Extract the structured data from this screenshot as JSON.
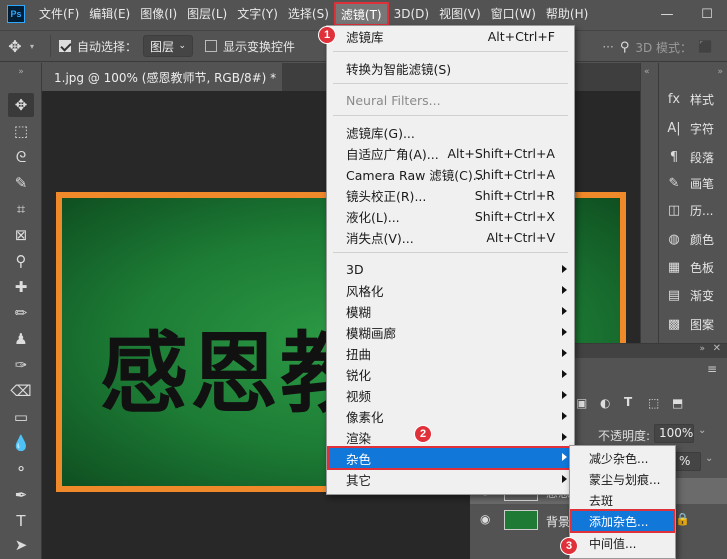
{
  "menubar": {
    "logo": "Ps",
    "items": [
      "文件(F)",
      "编辑(E)",
      "图像(I)",
      "图层(L)",
      "文字(Y)",
      "选择(S)",
      "滤镜(T)",
      "3D(D)",
      "视图(V)",
      "窗口(W)",
      "帮助(H)"
    ],
    "active_index": 6
  },
  "optionsbar": {
    "auto_select_label": "自动选择：",
    "auto_select_checked": true,
    "layer_dropdown": "图层",
    "show_transform_label": "显示变换控件",
    "mode_3d_label": "3D 模式："
  },
  "document": {
    "tab_title": "1.jpg @ 100% (感恩教师节, RGB/8#) *",
    "canvas_text": "感恩教师节"
  },
  "right_panel": {
    "items": [
      {
        "icon": "fx",
        "label": "样式"
      },
      {
        "icon": "A|",
        "label": "字符"
      },
      {
        "icon": "¶",
        "label": "段落"
      },
      {
        "icon": "✎",
        "label": "画笔"
      },
      {
        "icon": "◫",
        "label": "历..."
      },
      {
        "icon": "◍",
        "label": "颜色"
      },
      {
        "icon": "▦",
        "label": "色板"
      },
      {
        "icon": "▤",
        "label": "渐变"
      },
      {
        "icon": "▩",
        "label": "图案"
      }
    ]
  },
  "layers": {
    "opacity_label": "不透明度:",
    "opacity_value": "100%",
    "fill_value": "%",
    "layer_partial": "感恩",
    "background_label": "背景"
  },
  "filter_menu": {
    "items": [
      {
        "label": "滤镜库",
        "shortcut": "Alt+Ctrl+F"
      },
      {
        "label": "转换为智能滤镜(S)",
        "shortcut": ""
      },
      {
        "label": "Neural Filters...",
        "shortcut": "",
        "disabled": true
      },
      {
        "label": "滤镜库(G)...",
        "shortcut": ""
      },
      {
        "label": "自适应广角(A)...",
        "shortcut": "Alt+Shift+Ctrl+A"
      },
      {
        "label": "Camera Raw 滤镜(C)...",
        "shortcut": "Shift+Ctrl+A"
      },
      {
        "label": "镜头校正(R)...",
        "shortcut": "Shift+Ctrl+R"
      },
      {
        "label": "液化(L)...",
        "shortcut": "Shift+Ctrl+X"
      },
      {
        "label": "消失点(V)...",
        "shortcut": "Alt+Ctrl+V"
      },
      {
        "label": "3D",
        "submenu": true
      },
      {
        "label": "风格化",
        "submenu": true
      },
      {
        "label": "模糊",
        "submenu": true
      },
      {
        "label": "模糊画廊",
        "submenu": true
      },
      {
        "label": "扭曲",
        "submenu": true
      },
      {
        "label": "锐化",
        "submenu": true
      },
      {
        "label": "视频",
        "submenu": true
      },
      {
        "label": "像素化",
        "submenu": true
      },
      {
        "label": "渲染",
        "submenu": true
      },
      {
        "label": "杂色",
        "submenu": true,
        "highlighted": true
      },
      {
        "label": "其它",
        "submenu": true
      }
    ]
  },
  "noise_menu": {
    "items": [
      {
        "label": "减少杂色..."
      },
      {
        "label": "蒙尘与划痕..."
      },
      {
        "label": "去斑"
      },
      {
        "label": "添加杂色...",
        "highlighted": true
      },
      {
        "label": "中间值..."
      }
    ]
  },
  "badges": [
    "1",
    "2",
    "3"
  ],
  "colors": {
    "accent_red": "#e0303a",
    "highlight_blue": "#1177d9",
    "artboard_orange": "#f0892a",
    "board_green": "#1c7a34"
  }
}
